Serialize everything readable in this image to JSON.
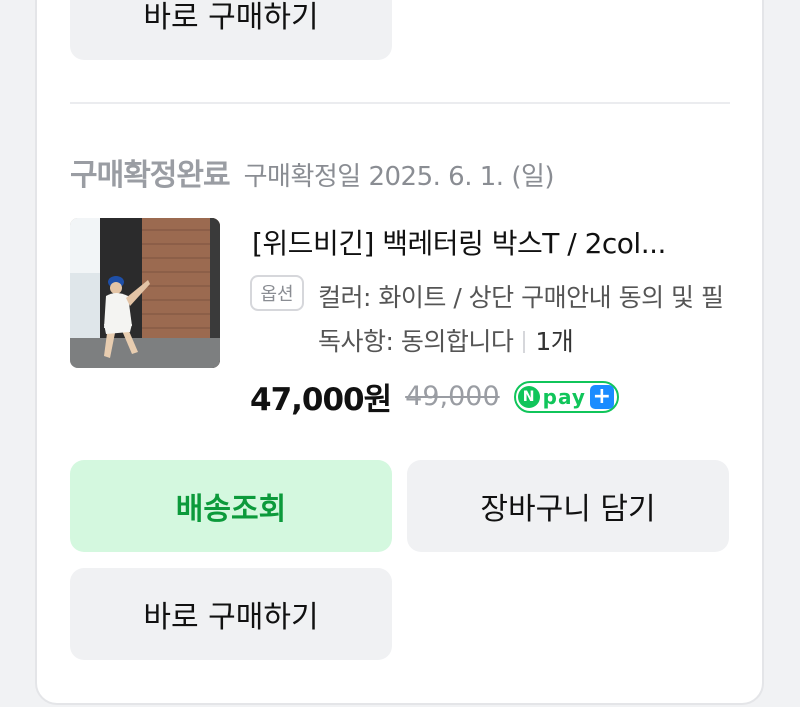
{
  "top_button": {
    "label": "바로 구매하기"
  },
  "order": {
    "status": "구매확정완료",
    "confirm_date": "구매확정일 2025. 6. 1. (일)"
  },
  "product": {
    "title": "[위드비긴] 백레터링 박스T / 2col...",
    "option_badge": "옵션",
    "option_text": "컬러: 화이트 / 상단 구매안내 동의 및 필독사항: 동의합니다",
    "quantity": "1개",
    "price": "47,000원",
    "original_price": "49,000",
    "pay_badge": {
      "n": "N",
      "pay": "pay",
      "plus": "+"
    }
  },
  "buttons": {
    "track": "배송조회",
    "cart": "장바구니 담기",
    "buy": "바로 구매하기"
  },
  "colors": {
    "track_bg": "#d4f8df",
    "track_text": "#0c9a3b",
    "npay_green": "#10c55a",
    "npay_plus": "#1a8cff"
  }
}
